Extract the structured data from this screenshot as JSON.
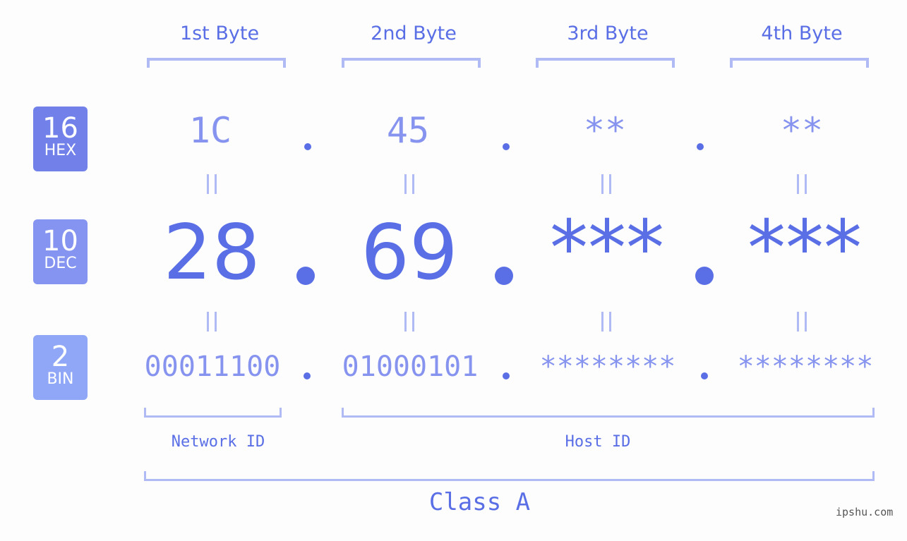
{
  "headers": [
    "1st Byte",
    "2nd Byte",
    "3rd Byte",
    "4th Byte"
  ],
  "badges": {
    "hex": {
      "number": "16",
      "label": "HEX",
      "color": "#7281ea"
    },
    "dec": {
      "number": "10",
      "label": "DEC",
      "color": "#8494f0"
    },
    "bin": {
      "number": "2",
      "label": "BIN",
      "color": "#8fa7f6"
    }
  },
  "hex_values": [
    "1C",
    "45",
    "**",
    "**"
  ],
  "dec_values": [
    "28",
    "69",
    "***",
    "***"
  ],
  "bin_values": [
    "00011100",
    "01000101",
    "********",
    "********"
  ],
  "network_label": "Network ID",
  "host_label": "Host ID",
  "class_label": "Class A",
  "watermark": "ipshu.com",
  "colors": {
    "accent": "#5a6ee6",
    "light": "#8794ef",
    "bracket": "#b0bbf6"
  }
}
